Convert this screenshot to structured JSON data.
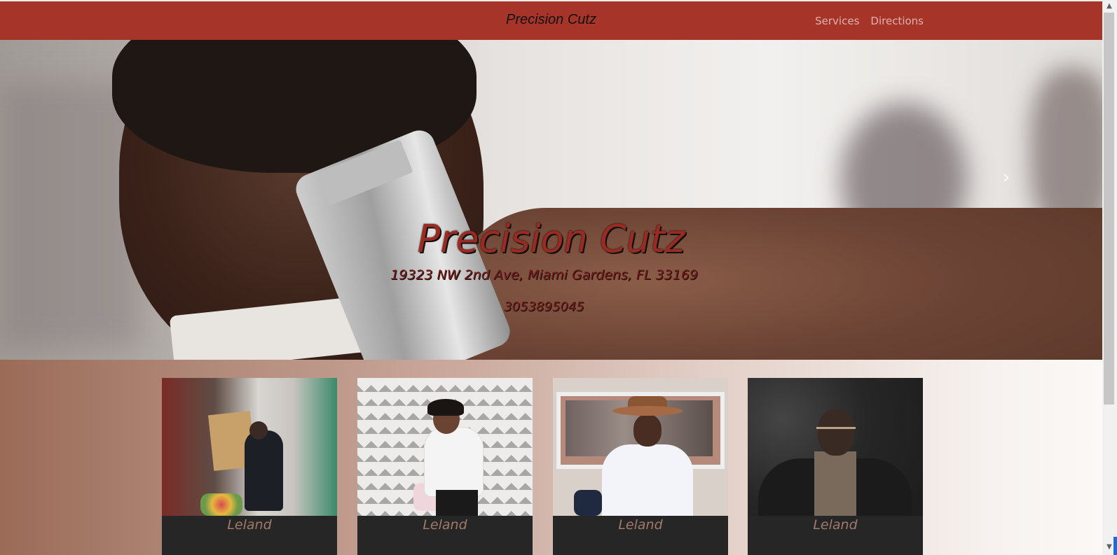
{
  "navbar": {
    "brand": "Precision Cutz",
    "links": [
      {
        "label": "Services"
      },
      {
        "label": "Directions"
      }
    ]
  },
  "hero": {
    "title": "Precision Cutz",
    "address": "19323 NW 2nd Ave, Miami Gardens, FL 33169",
    "phone": "3053895045",
    "next_icon": "chevron-right-icon"
  },
  "cards": [
    {
      "name": "Leland"
    },
    {
      "name": "Leland"
    },
    {
      "name": "Leland"
    },
    {
      "name": "Leland"
    }
  ],
  "colors": {
    "navbar_bg": "#a63428",
    "hero_title": "#9a2a22",
    "card_footer": "#262626",
    "card_name": "#a27a6a"
  }
}
